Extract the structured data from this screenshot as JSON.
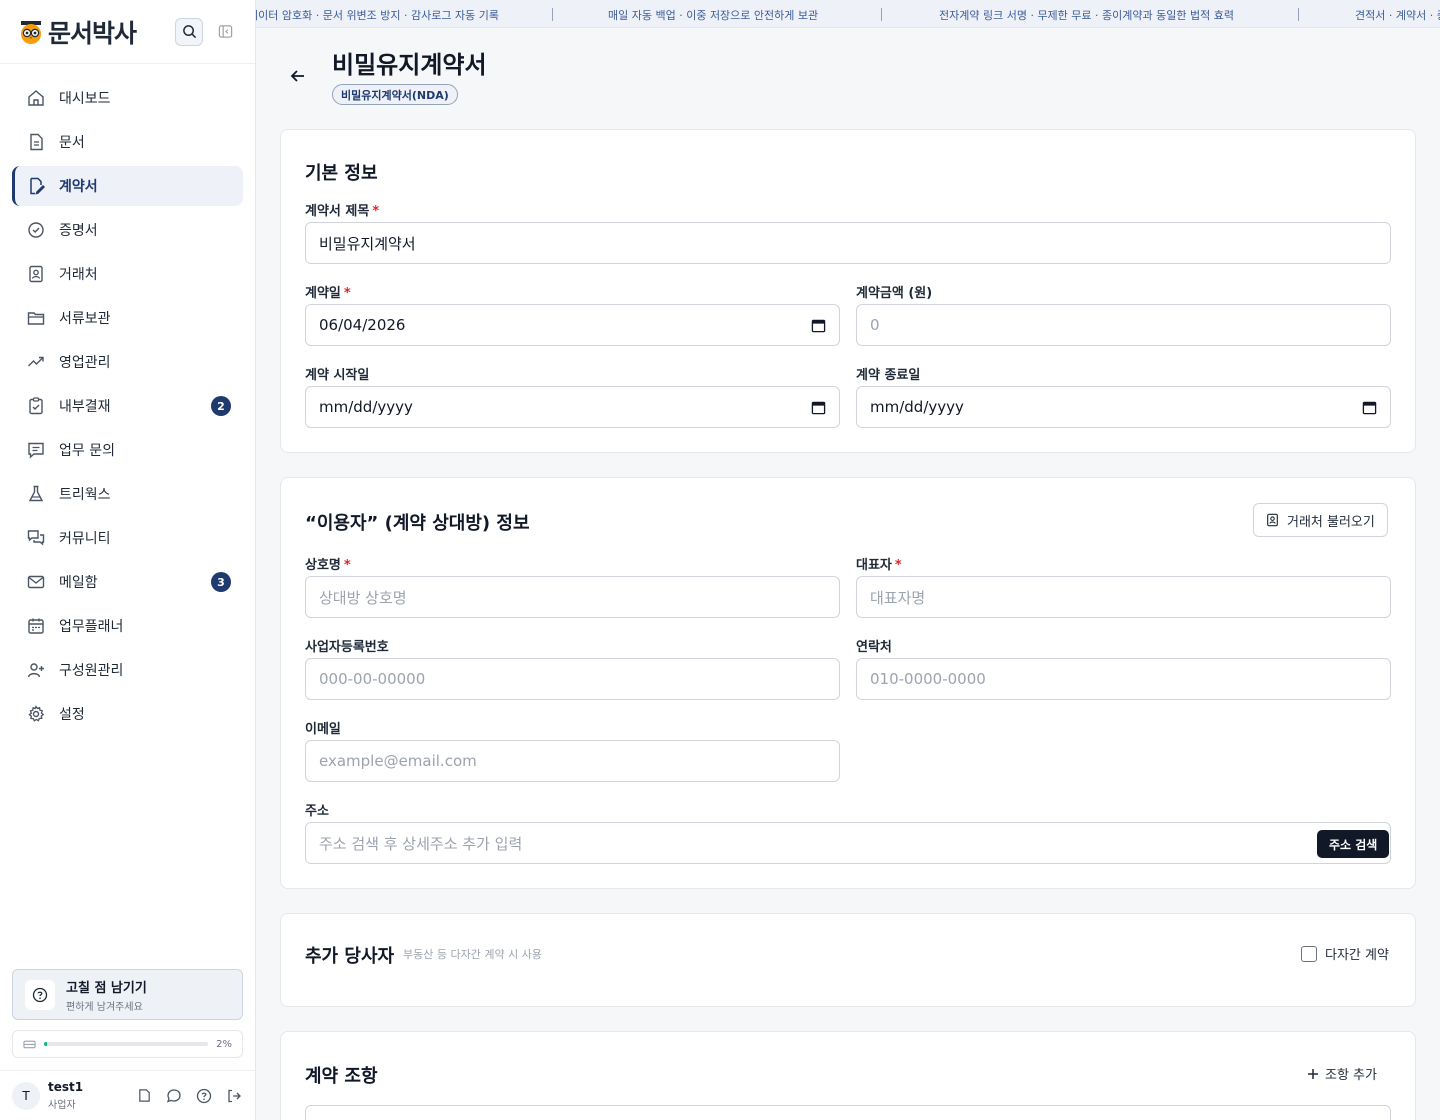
{
  "brand": {
    "name": "문서박사"
  },
  "ticker": [
    "데이터 암호화 · 문서 위변조 방지 · 감사로그 자동 기록",
    "매일 자동 백업 · 이중 저장으로 안전하게 보관",
    "전자계약 링크 서명 · 무제한 무료 · 종이계약과 동일한 법적 효력",
    "견적서 · 계약서 · 증명서"
  ],
  "nav": [
    {
      "label": "대시보드",
      "icon": "home-icon"
    },
    {
      "label": "문서",
      "icon": "document-icon"
    },
    {
      "label": "계약서",
      "icon": "contract-edit-icon",
      "active": true
    },
    {
      "label": "증명서",
      "icon": "certificate-check-icon"
    },
    {
      "label": "거래처",
      "icon": "contact-book-icon"
    },
    {
      "label": "서류보관",
      "icon": "folder-icon"
    },
    {
      "label": "영업관리",
      "icon": "trend-up-icon"
    },
    {
      "label": "내부결재",
      "icon": "clipboard-check-icon",
      "badge": "2"
    },
    {
      "label": "업무 문의",
      "icon": "message-square-icon"
    },
    {
      "label": "트리웍스",
      "icon": "flask-icon"
    },
    {
      "label": "커뮤니티",
      "icon": "chat-bubbles-icon"
    },
    {
      "label": "메일함",
      "icon": "mail-icon",
      "badge": "3"
    },
    {
      "label": "업무플래너",
      "icon": "calendar-icon"
    },
    {
      "label": "구성원관리",
      "icon": "user-plus-icon"
    },
    {
      "label": "설정",
      "icon": "gear-icon"
    }
  ],
  "feedback": {
    "title": "고칠 점 남기기",
    "subtitle": "편하게 남겨주세요"
  },
  "storage": {
    "percent_label": "2%",
    "fraction": 0.02
  },
  "user": {
    "initial": "T",
    "name": "test1",
    "role": "사업자"
  },
  "header": {
    "title": "비밀유지계약서",
    "type_chip": "비밀유지계약서(NDA)"
  },
  "basic": {
    "title": "기본 정보",
    "contract_title_label": "계약서 제목",
    "contract_title_value": "비밀유지계약서",
    "contract_date_label": "계약일",
    "contract_date_value": "06/04/2026",
    "amount_label": "계약금액 (원)",
    "amount_placeholder": "0",
    "start_label": "계약 시작일",
    "start_value": "mm/dd/yyyy",
    "end_label": "계약 종료일",
    "end_value": "mm/dd/yyyy"
  },
  "party": {
    "title": "“이용자” (계약 상대방) 정보",
    "load_button": "거래처 불러오기",
    "company_label": "상호명",
    "company_placeholder": "상대방 상호명",
    "ceo_label": "대표자",
    "ceo_placeholder": "대표자명",
    "bizno_label": "사업자등록번호",
    "bizno_placeholder": "000-00-00000",
    "phone_label": "연락처",
    "phone_placeholder": "010-0000-0000",
    "email_label": "이메일",
    "email_placeholder": "example@email.com",
    "address_label": "주소",
    "address_placeholder": "주소 검색 후 상세주소 추가 입력",
    "address_button": "주소 검색"
  },
  "extra": {
    "title": "추가 당사자",
    "hint": "부동산 등 다자간 계약 시 사용",
    "checkbox_label": "다자간 계약"
  },
  "clauses": {
    "title": "계약 조항",
    "add_button": "조항 추가"
  },
  "colors": {
    "primary": "#1e3a6e",
    "required": "#dc2626",
    "ticker_text": "#3b5c98"
  }
}
